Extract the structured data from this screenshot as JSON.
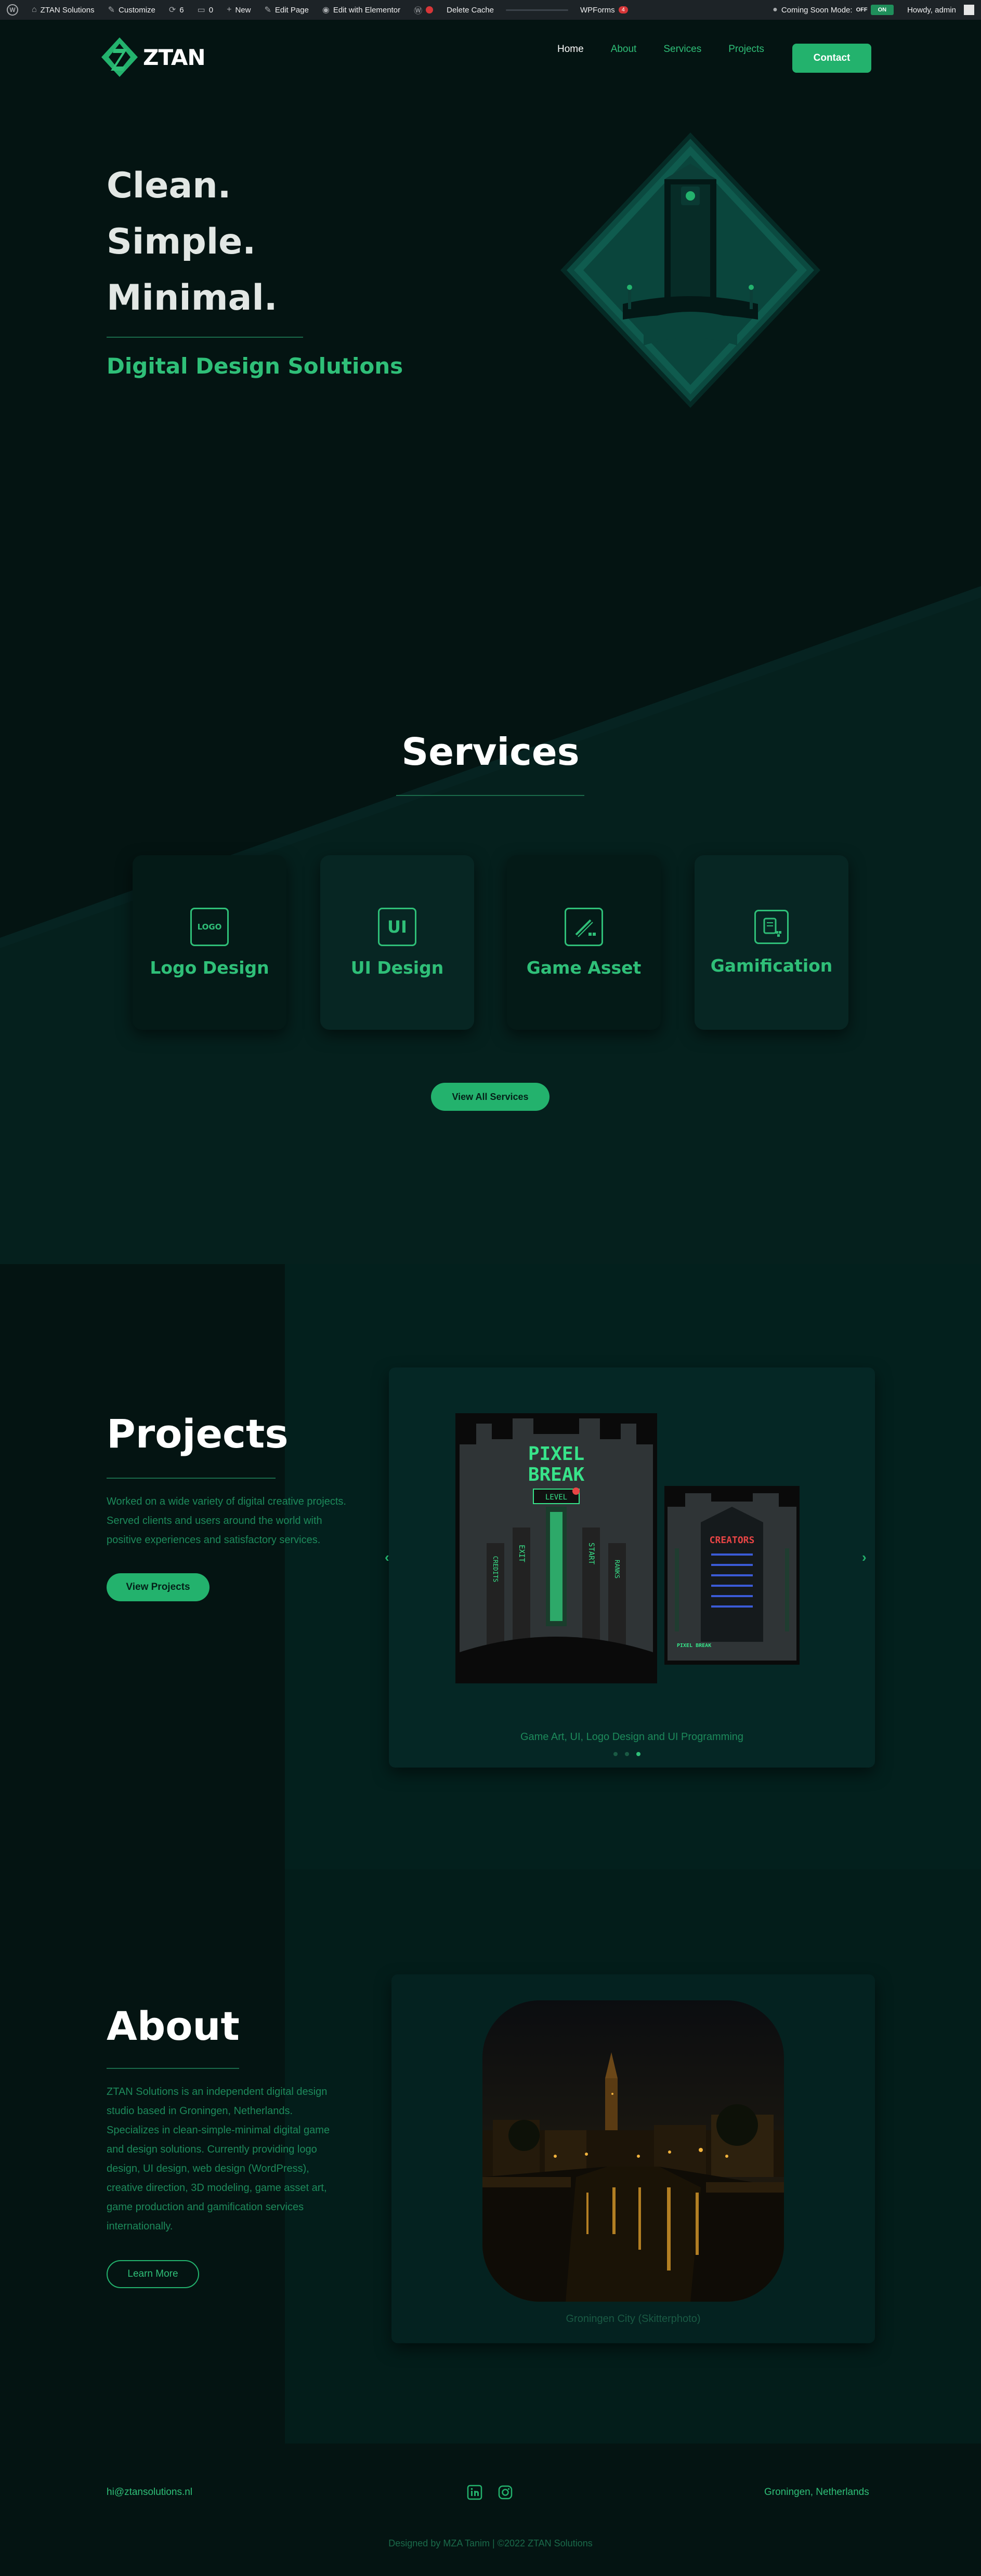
{
  "admin_bar": {
    "site_name": "ZTAN Solutions",
    "customize": "Customize",
    "updates_count": "6",
    "comments_count": "0",
    "new": "New",
    "edit_page": "Edit Page",
    "edit_elementor": "Edit with Elementor",
    "delete_cache": "Delete Cache",
    "wpforms": "WPForms",
    "wpforms_badge": "4",
    "coming_soon_label": "Coming Soon Mode:",
    "toggle_off": "OFF",
    "toggle_on": "ON",
    "howdy": "Howdy, admin"
  },
  "header": {
    "logo_text": "ZTAN",
    "nav": [
      "Home",
      "About",
      "Services",
      "Projects"
    ],
    "contact_label": "Contact"
  },
  "hero": {
    "lines": [
      "Clean.",
      "Simple.",
      "Minimal."
    ],
    "subtitle": "Digital Design Solutions"
  },
  "services": {
    "title": "Services",
    "cards": [
      {
        "label": "Logo Design",
        "icon": "logo-icon",
        "icon_text": "LOGO"
      },
      {
        "label": "UI Design",
        "icon": "ui-icon",
        "icon_text": "UI"
      },
      {
        "label": "Game Asset",
        "icon": "game-asset-icon",
        "icon_text": ""
      },
      {
        "label": "Gamification",
        "icon": "gamification-icon",
        "icon_text": ""
      }
    ],
    "button_label": "View All Services"
  },
  "projects": {
    "title": "Projects",
    "description": "Worked on a wide variety of digital creative projects. Served clients and users around the world with positive experiences and satisfactory services.",
    "button_label": "View Projects",
    "slide_caption": "Game Art, UI, Logo Design and UI Programming",
    "poster_title_1": "PIXEL",
    "poster_title_2": "BREAK",
    "poster_badge": "LEVEL",
    "poster_menu": [
      "CREDITS",
      "EXIT",
      "START",
      "RANKS"
    ],
    "poster2_title": "CREATORS",
    "poster2_logo": "PIXEL BREAK"
  },
  "about": {
    "title": "About",
    "description": "ZTAN Solutions is an independent digital design studio based in Groningen, Netherlands. Specializes in clean-simple-minimal digital game and design solutions. Currently providing logo design, UI design, web design (WordPress), creative direction, 3D modeling, game asset art, game production and gamification services internationally.",
    "button_label": "Learn More",
    "photo_caption": "Groningen City (Skitterphoto)"
  },
  "footer": {
    "email": "hi@ztansolutions.nl",
    "location": "Groningen, Netherlands",
    "credit": "Designed by MZA Tanim  |  ©2022 ZTAN Solutions",
    "social_icons": [
      "linkedin-icon",
      "instagram-icon"
    ]
  },
  "colors": {
    "accent": "#23b26d",
    "accent_text": "#2fbf78",
    "background": "#041412",
    "panel": "#03201d"
  }
}
